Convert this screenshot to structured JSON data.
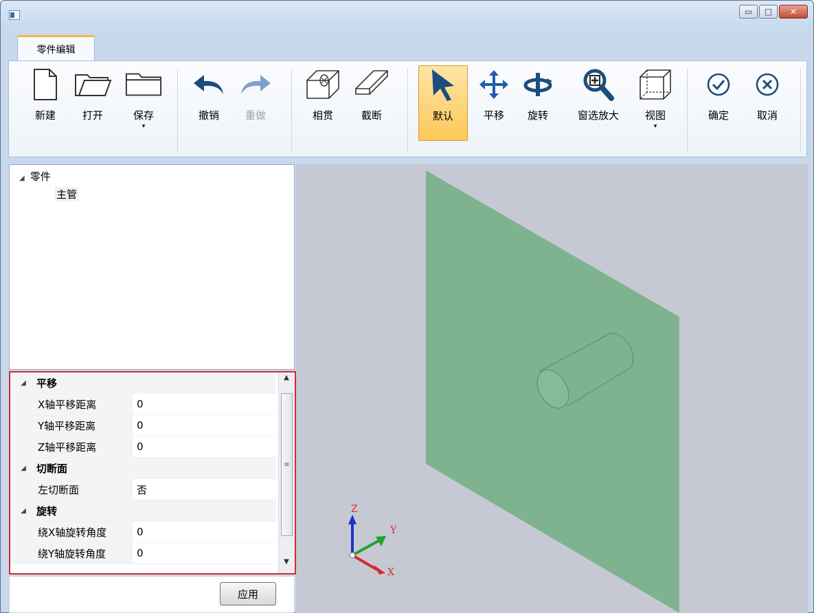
{
  "window": {
    "title": "",
    "controls": {
      "minimize": "▭",
      "maximize": "□",
      "close": "✕"
    }
  },
  "ribbon": {
    "tab_label": "零件编辑",
    "buttons": {
      "new": "新建",
      "open": "打开",
      "save": "保存",
      "undo": "撤销",
      "redo": "重做",
      "intersect": "相贯",
      "cut": "截断",
      "default": "默认",
      "pan": "平移",
      "rotate": "旋转",
      "zoom_window": "窗选放大",
      "view": "视图",
      "confirm": "确定",
      "cancel": "取消"
    },
    "dropdown_glyph": "▾"
  },
  "tree": {
    "root": "零件",
    "children": [
      "主管"
    ]
  },
  "properties": {
    "categories": [
      {
        "name": "平移",
        "rows": [
          {
            "name": "X轴平移距离",
            "value": "0"
          },
          {
            "name": "Y轴平移距离",
            "value": "0"
          },
          {
            "name": "Z轴平移距离",
            "value": "0"
          }
        ]
      },
      {
        "name": "切断面",
        "rows": [
          {
            "name": "左切断面",
            "value": "否"
          }
        ]
      },
      {
        "name": "旋转",
        "rows": [
          {
            "name": "绕X轴旋转角度",
            "value": "0"
          },
          {
            "name": "绕Y轴旋转角度",
            "value": "0"
          }
        ]
      }
    ],
    "scroll": {
      "up": "▲",
      "down": "▼",
      "grip": "≡"
    }
  },
  "apply": {
    "label": "应用"
  },
  "viewport": {
    "background": "#c6c9d3",
    "plate_color": "#7fb390",
    "axes": {
      "x": "X",
      "y": "Y",
      "z": "Z"
    },
    "axis_colors": {
      "x": "#d42a2a",
      "y": "#1fa32c",
      "z": "#1a33c9"
    }
  }
}
